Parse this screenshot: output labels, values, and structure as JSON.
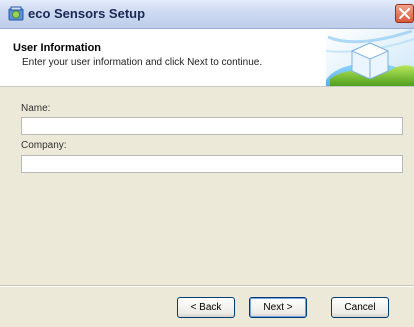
{
  "window": {
    "title": "eco Sensors Setup"
  },
  "header": {
    "title": "User Information",
    "subtitle": "Enter your user information and click Next to continue."
  },
  "form": {
    "name_label": "Name:",
    "name_value": "",
    "company_label": "Company:",
    "company_value": ""
  },
  "buttons": {
    "back_label": "< Back",
    "next_label": "Next >",
    "cancel_label": "Cancel"
  },
  "icons": {
    "app": "installer-app-icon",
    "close": "close-icon",
    "logo": "setup-globe-cube-logo"
  }
}
